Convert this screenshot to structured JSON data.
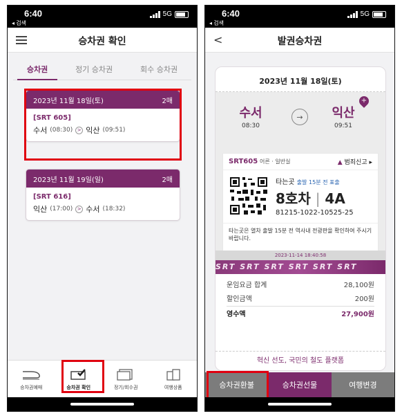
{
  "left": {
    "status": {
      "time": "6:40",
      "back_label": "◂ 검색",
      "network": "5G"
    },
    "header": {
      "title": "승차권 확인"
    },
    "tabs": [
      "승차권",
      "정기 승차권",
      "회수 승차권"
    ],
    "tickets": [
      {
        "date": "2023년 11월 18일(토)",
        "count": "2매",
        "train": "[SRT 605]",
        "from": "수서",
        "from_time": "(08:30)",
        "to": "익산",
        "to_time": "(09:51)"
      },
      {
        "date": "2023년 11월 19일(일)",
        "count": "2매",
        "train": "[SRT 616]",
        "from": "익산",
        "from_time": "(17:00)",
        "to": "수서",
        "to_time": "(18:32)"
      }
    ],
    "tabbar": [
      "승차권예매",
      "승차권 확인",
      "정기/회수권",
      "여행상품"
    ]
  },
  "right": {
    "status": {
      "time": "6:40",
      "back_label": "◂ 검색",
      "network": "5G"
    },
    "header": {
      "title": "발권승차권",
      "back": "<"
    },
    "ticket": {
      "date": "2023년 11월 18일(토)",
      "from": "수서",
      "from_time": "08:30",
      "to": "익산",
      "to_time": "09:51",
      "train": "SRT605",
      "train_sub": "어른 · 일반실",
      "report": "범죄신고 ▸",
      "board_label": "타는곳",
      "board_note": "출발 15분 전 표출",
      "car": "8호차",
      "seat": "4A",
      "ticket_no": "81215-1022-10525-25",
      "notice": "타는곳은 열차 출발 15분 전 역사내 전광판을 확인하여 주시기 바랍니다.",
      "stamp": "2023-11-14 18:40:58",
      "band": "SRT SRT SRT SRT SRT SRT",
      "fare_rows": [
        {
          "label": "운임요금 합계",
          "value": "28,100원"
        },
        {
          "label": "할인금액",
          "value": "200원"
        }
      ],
      "total": {
        "label": "영수액",
        "value": "27,900원"
      },
      "slogan": "혁신 선도, 국민의 철도 플랫폼"
    },
    "actions": [
      "승차권환불",
      "승차권선물",
      "여행변경"
    ]
  }
}
